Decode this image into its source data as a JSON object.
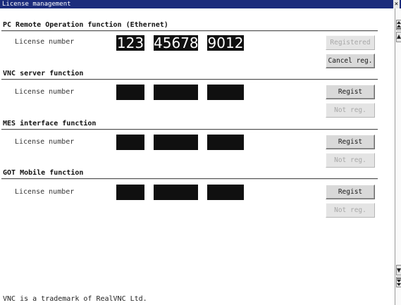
{
  "window": {
    "title": "License management",
    "close_label": "×"
  },
  "sections": [
    {
      "heading": "PC Remote Operation function (Ethernet)",
      "license_label": "License number",
      "fields": [
        "123",
        "45678",
        "9012"
      ],
      "primary_button": {
        "label": "Registered",
        "enabled": false
      },
      "secondary_button": {
        "label": "Cancel reg.",
        "enabled": true
      }
    },
    {
      "heading": "VNC server function",
      "license_label": "License number",
      "fields": [
        "",
        "",
        ""
      ],
      "primary_button": {
        "label": "Regist",
        "enabled": true
      },
      "secondary_button": {
        "label": "Not reg.",
        "enabled": false
      }
    },
    {
      "heading": "MES interface function",
      "license_label": "License number",
      "fields": [
        "",
        "",
        ""
      ],
      "primary_button": {
        "label": "Regist",
        "enabled": true
      },
      "secondary_button": {
        "label": "Not reg.",
        "enabled": false
      }
    },
    {
      "heading": "GOT Mobile function",
      "license_label": "License number",
      "fields": [
        "",
        "",
        ""
      ],
      "primary_button": {
        "label": "Regist",
        "enabled": true
      },
      "secondary_button": {
        "label": "Not reg.",
        "enabled": false
      }
    }
  ],
  "footer_text": "VNC is a trademark of RealVNC Ltd.",
  "scrollbar": {
    "icons": [
      "scroll-top-icon",
      "scroll-up-icon",
      "scroll-down-icon",
      "scroll-bottom-icon"
    ]
  },
  "colors": {
    "titlebar": "#1c2c7c",
    "field_background": "#101010",
    "button_face": "#d9d9d9",
    "disabled_text": "#a8a8a8"
  }
}
